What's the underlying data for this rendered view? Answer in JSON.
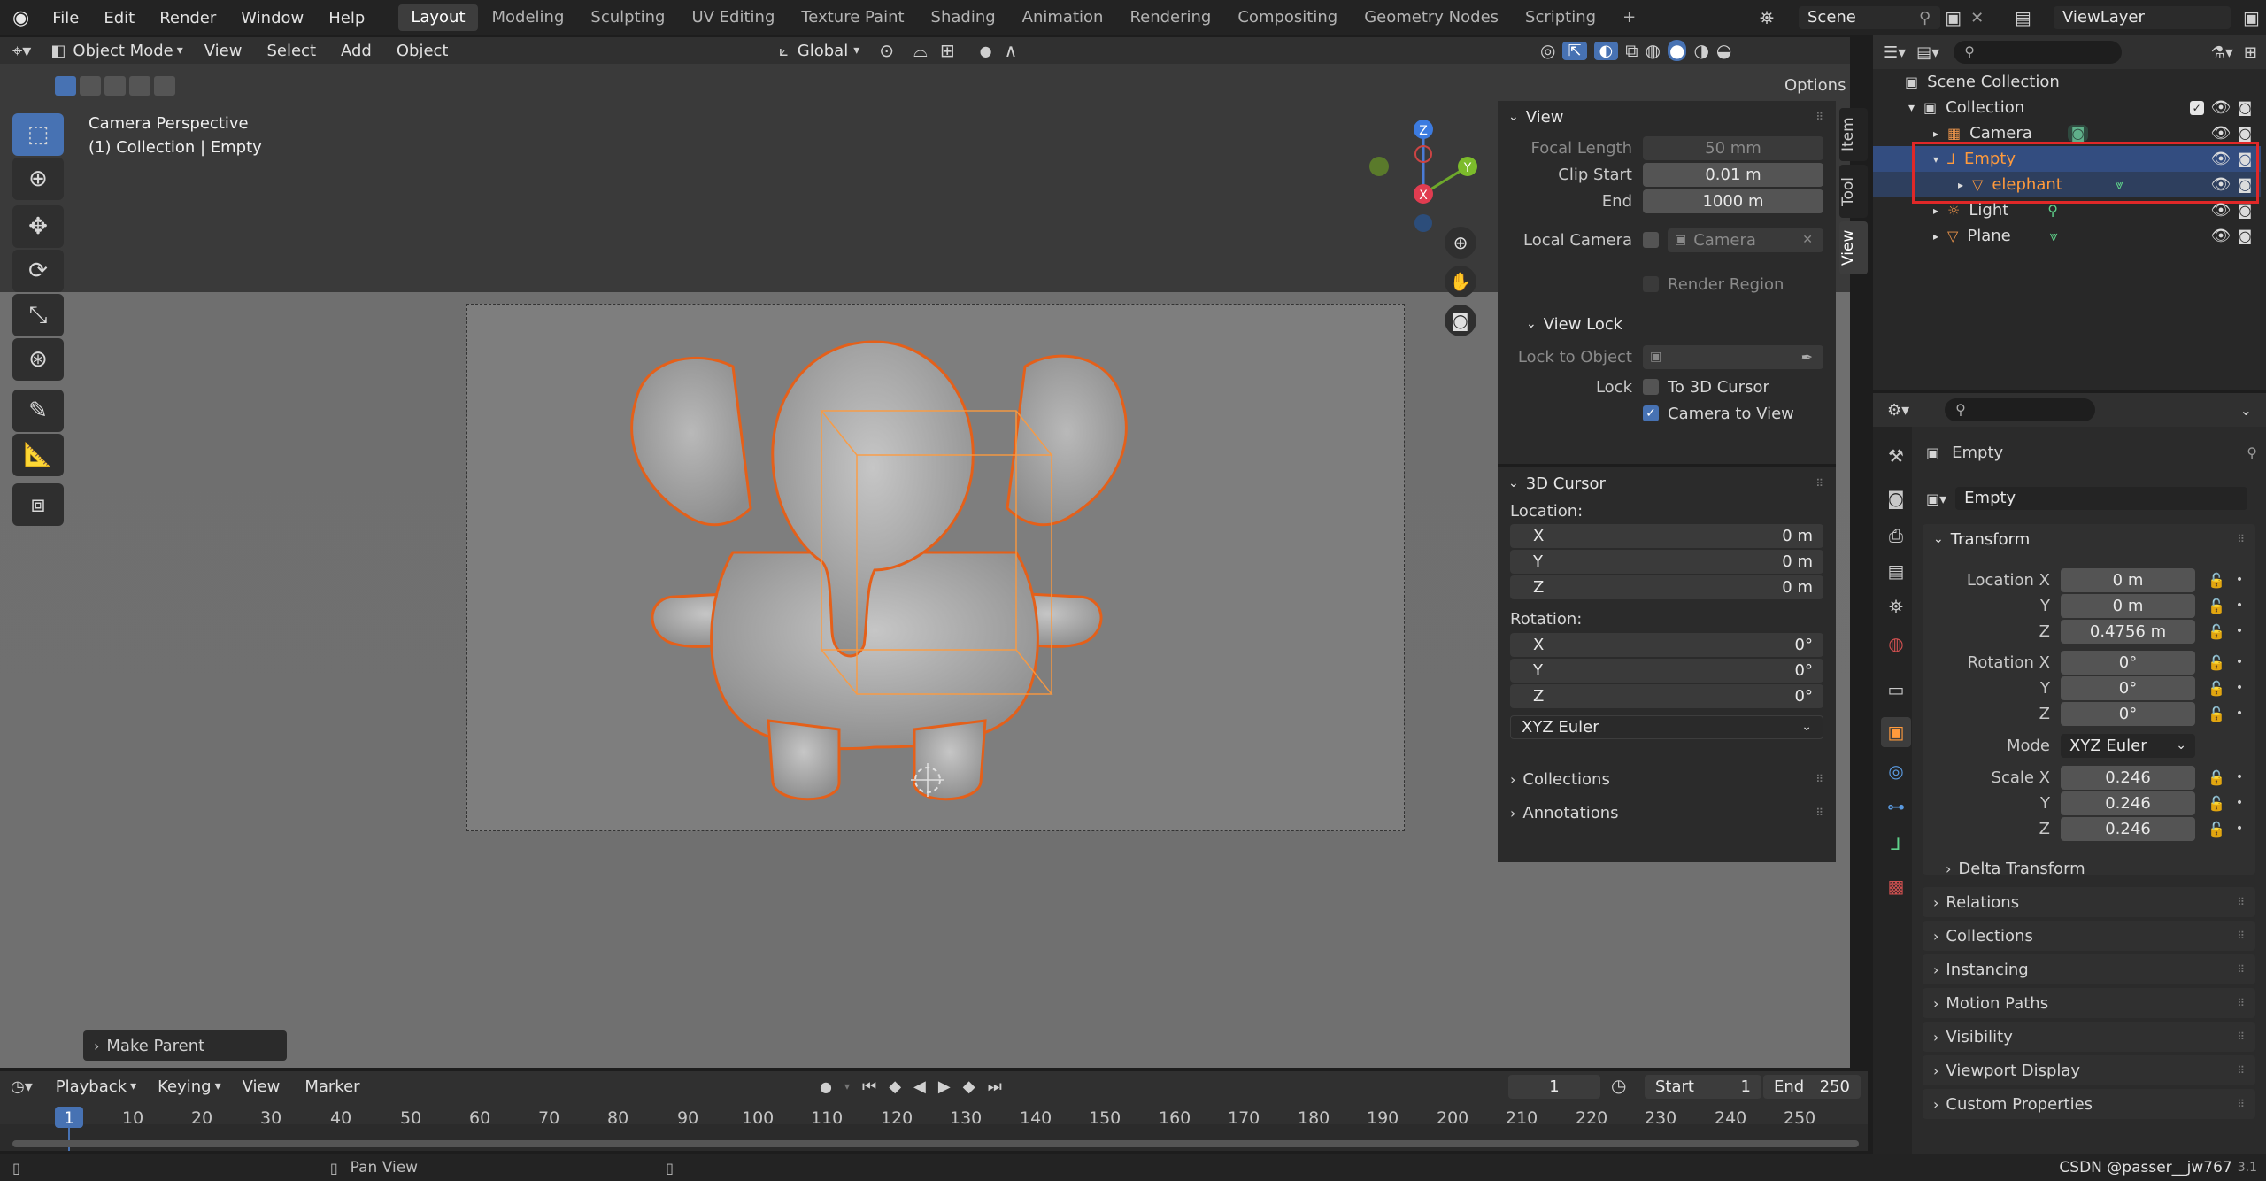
{
  "topbar": {
    "menus": [
      "File",
      "Edit",
      "Render",
      "Window",
      "Help"
    ],
    "workspaces": [
      "Layout",
      "Modeling",
      "Sculpting",
      "UV Editing",
      "Texture Paint",
      "Shading",
      "Animation",
      "Rendering",
      "Compositing",
      "Geometry Nodes",
      "Scripting"
    ],
    "active_workspace": "Layout",
    "add_tab": "+",
    "scene": "Scene",
    "view_layer": "ViewLayer"
  },
  "viewport_header": {
    "mode": "Object Mode",
    "menus": [
      "View",
      "Select",
      "Add",
      "Object"
    ],
    "orientation": "Global",
    "options": "Options"
  },
  "viewport": {
    "overlay_line1": "Camera Perspective",
    "overlay_line2": "(1) Collection | Empty",
    "gizmo": {
      "z": "Z",
      "x": "X",
      "y": "Y"
    },
    "last_op": "Make Parent"
  },
  "npanel": {
    "tabs": [
      "Item",
      "Tool",
      "View"
    ],
    "view": {
      "title": "View",
      "focal_length_label": "Focal Length",
      "focal_length": "50 mm",
      "clip_start_label": "Clip Start",
      "clip_start": "0.01 m",
      "end_label": "End",
      "end": "1000 m",
      "local_camera_label": "Local Camera",
      "local_camera": "Camera",
      "render_region": "Render Region",
      "view_lock_title": "View Lock",
      "lock_to_object_label": "Lock to Object",
      "lock_label": "Lock",
      "to_3d_cursor": "To 3D Cursor",
      "camera_to_view": "Camera to View"
    },
    "cursor": {
      "title": "3D Cursor",
      "location_label": "Location:",
      "loc": [
        {
          "axis": "X",
          "value": "0 m"
        },
        {
          "axis": "Y",
          "value": "0 m"
        },
        {
          "axis": "Z",
          "value": "0 m"
        }
      ],
      "rotation_label": "Rotation:",
      "rot": [
        {
          "axis": "X",
          "value": "0°"
        },
        {
          "axis": "Y",
          "value": "0°"
        },
        {
          "axis": "Z",
          "value": "0°"
        }
      ],
      "rot_mode": "XYZ Euler"
    },
    "collections": "Collections",
    "annotations": "Annotations"
  },
  "outliner": {
    "items": [
      {
        "name": "Scene Collection"
      },
      {
        "name": "Collection"
      },
      {
        "name": "Camera"
      },
      {
        "name": "Empty"
      },
      {
        "name": "elephant"
      },
      {
        "name": "Light"
      },
      {
        "name": "Plane"
      }
    ]
  },
  "properties": {
    "object_name": "Empty",
    "datablock": "Empty",
    "transform_title": "Transform",
    "location_x_label": "Location X",
    "location": [
      "0 m",
      "0 m",
      "0.4756 m"
    ],
    "rotation_x_label": "Rotation X",
    "rotation": [
      "0°",
      "0°",
      "0°"
    ],
    "mode_label": "Mode",
    "mode": "XYZ Euler",
    "scale_x_label": "Scale X",
    "scale": [
      "0.246",
      "0.246",
      "0.246"
    ],
    "y_label": "Y",
    "z_label": "Z",
    "sections": [
      "Delta Transform",
      "Relations",
      "Collections",
      "Instancing",
      "Motion Paths",
      "Visibility",
      "Viewport Display",
      "Custom Properties"
    ]
  },
  "timeline": {
    "menus": [
      "Playback",
      "Keying",
      "View",
      "Marker"
    ],
    "current_frame": "1",
    "start_label": "Start",
    "start": "1",
    "end_label": "End",
    "end": "250",
    "ticks": [
      "1",
      "10",
      "20",
      "30",
      "40",
      "50",
      "60",
      "70",
      "80",
      "90",
      "100",
      "110",
      "120",
      "130",
      "140",
      "150",
      "160",
      "170",
      "180",
      "190",
      "200",
      "210",
      "220",
      "230",
      "240",
      "250"
    ]
  },
  "statusbar": {
    "pan_view": "Pan View",
    "watermark": "CSDN @passer__jw767",
    "version": "3.1"
  },
  "colors": {
    "accent": "#4772b3",
    "selection": "#334d80",
    "highlight_box": "#e02828",
    "selected_text": "#ff9a3c"
  }
}
